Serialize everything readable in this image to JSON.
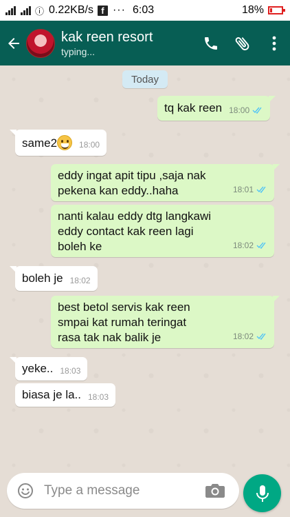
{
  "status_bar": {
    "speed": "0.22KB/s",
    "time": "6:03",
    "battery": "18%",
    "battery_level": 0.18
  },
  "header": {
    "contact_name": "kak reen resort",
    "contact_status": "typing..."
  },
  "chat": {
    "date_label": "Today",
    "messages": [
      {
        "dir": "out",
        "text": "tq kak reen",
        "time": "18:00",
        "read": true
      },
      {
        "dir": "in",
        "text": "same2",
        "time": "18:00",
        "emoji": "grinning-face"
      },
      {
        "dir": "out",
        "text": "eddy ingat apit tipu ,saja nak pekena kan eddy..haha",
        "time": "18:01",
        "read": true
      },
      {
        "dir": "out",
        "text": "nanti kalau eddy dtg langkawi eddy contact kak reen lagi boleh ke",
        "time": "18:02",
        "read": true
      },
      {
        "dir": "in",
        "text": "boleh je",
        "time": "18:02"
      },
      {
        "dir": "out",
        "text": "best betol servis kak reen smpai kat rumah teringat rasa tak nak balik je",
        "time": "18:02",
        "read": true
      },
      {
        "dir": "in",
        "text": "yeke..",
        "time": "18:03"
      },
      {
        "dir": "in",
        "text": "biasa je la..",
        "time": "18:03"
      }
    ],
    "lines": {
      "m2": [
        "eddy ingat apit tipu ,saja nak",
        "pekena kan eddy..haha"
      ],
      "m3": [
        "nanti kalau eddy dtg langkawi",
        "eddy contact kak reen lagi",
        "boleh ke"
      ],
      "m5": [
        "best betol servis kak reen",
        "smpai kat rumah teringat",
        "rasa tak nak balik je"
      ]
    }
  },
  "input": {
    "placeholder": "Type a message"
  },
  "colors": {
    "header": "#075e54",
    "outgoing_bubble": "#dcf8c6",
    "incoming_bubble": "#ffffff",
    "chat_bg": "#e5ddd5",
    "read_ticks": "#4fc3f7",
    "mic_button": "#00a884"
  }
}
